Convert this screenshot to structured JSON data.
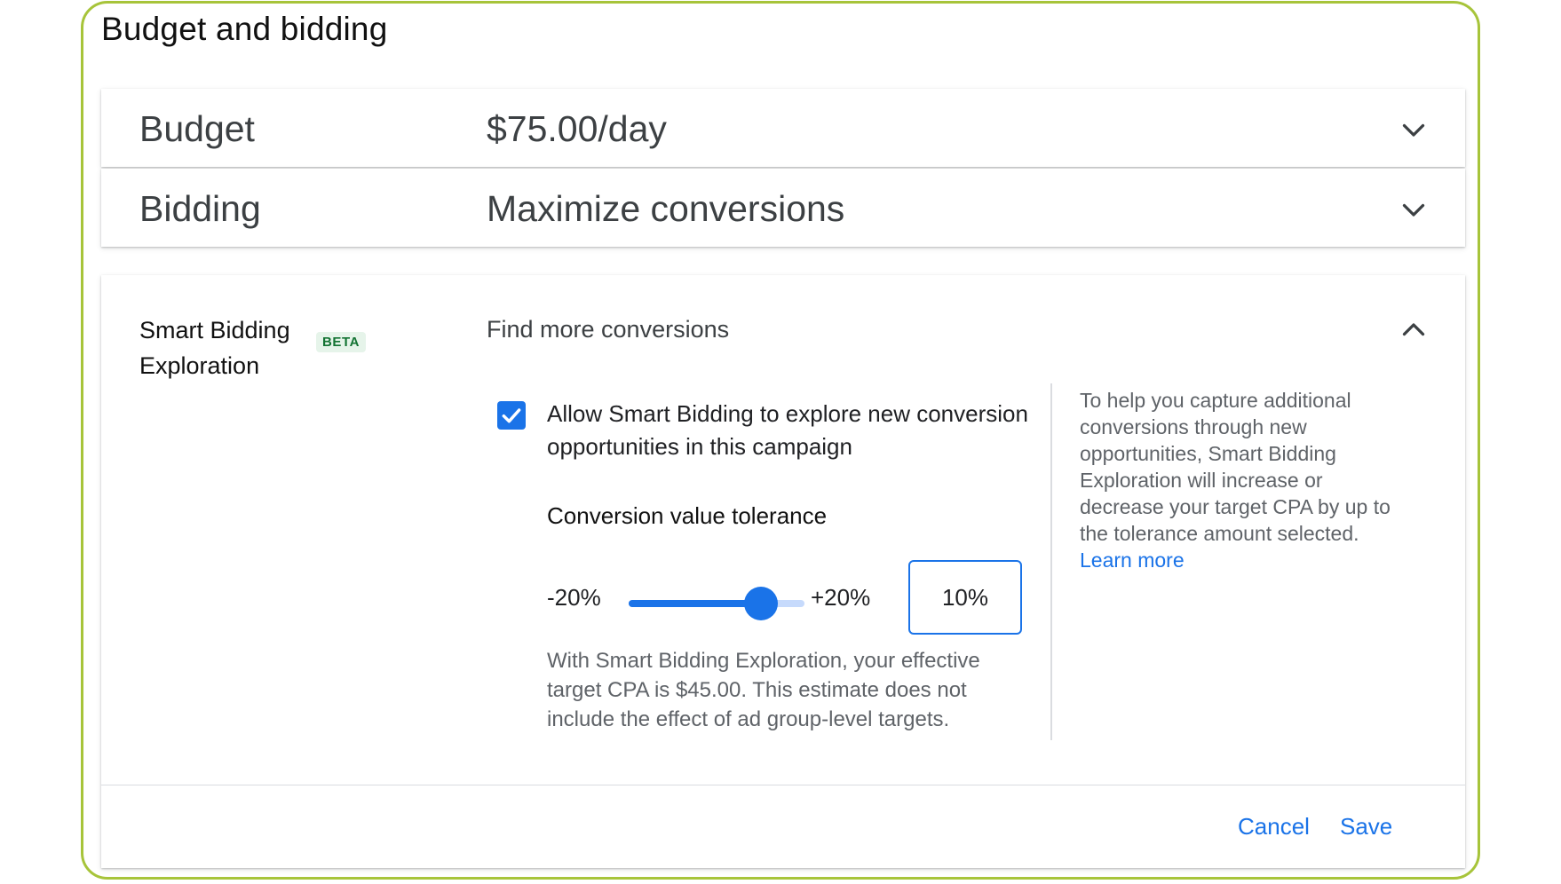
{
  "section": {
    "title": "Budget and bidding"
  },
  "budget": {
    "label": "Budget",
    "value": "$75.00/day"
  },
  "bidding": {
    "label": "Bidding",
    "value": "Maximize conversions"
  },
  "exploration": {
    "title": "Smart Bidding Exploration",
    "badge": "BETA",
    "heading": "Find more conversions",
    "checkbox": {
      "label": "Allow Smart Bidding to explore new conversion opportunities in this campaign",
      "checked": true
    },
    "tolerance": {
      "label": "Conversion value tolerance",
      "min_label": "-20%",
      "max_label": "+20%",
      "min": -20,
      "max": 20,
      "value": 10,
      "input_value": "10%"
    },
    "estimate": "With Smart Bidding Exploration, your effective target CPA is $45.00. This estimate does not include the effect of ad group-level targets.",
    "help_text": "To help you capture additional conversions through new opportunities, Smart Bidding Exploration will increase or decrease your target CPA by up to the tolerance amount selected.",
    "learn_more": "Learn more"
  },
  "footer": {
    "cancel_label": "Cancel",
    "save_label": "Save"
  },
  "icons": {
    "expand": "chevron-down-icon",
    "collapse": "chevron-up-icon",
    "check": "check-icon"
  },
  "colors": {
    "accent": "#1a73e8",
    "frame_border": "#a7c43a",
    "badge_bg": "#e6f4ea",
    "badge_text": "#137333"
  }
}
